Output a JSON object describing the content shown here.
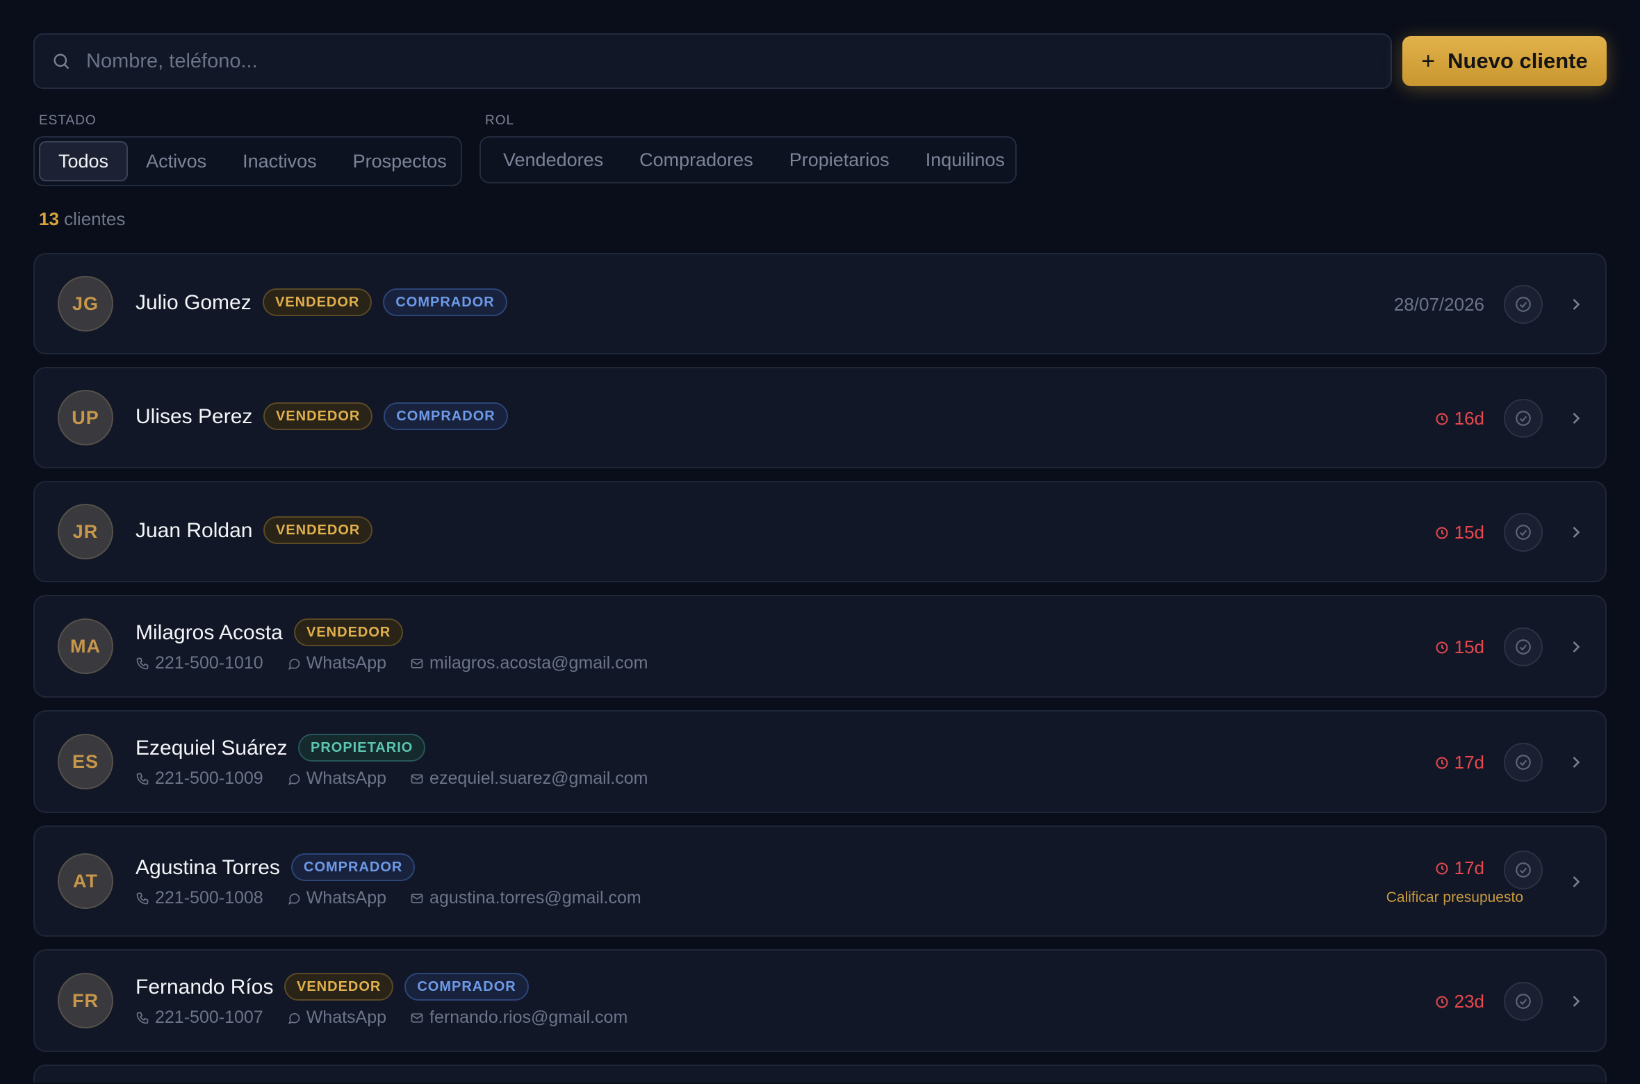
{
  "search": {
    "placeholder": "Nombre, teléfono..."
  },
  "new_client_button": {
    "label": "Nuevo cliente"
  },
  "filters": {
    "estado": {
      "label": "ESTADO",
      "options": [
        "Todos",
        "Activos",
        "Inactivos",
        "Prospectos"
      ],
      "selected": "Todos"
    },
    "rol": {
      "label": "ROL",
      "options": [
        "Vendedores",
        "Compradores",
        "Propietarios",
        "Inquilinos"
      ]
    }
  },
  "summary": {
    "count": "13",
    "suffix": "clientes"
  },
  "clients": [
    {
      "initials": "JG",
      "name": "Julio Gomez",
      "roles": [
        "VENDEDOR",
        "COMPRADOR"
      ],
      "status_text": "28/07/2026",
      "status_kind": "date"
    },
    {
      "initials": "UP",
      "name": "Ulises Perez",
      "roles": [
        "VENDEDOR",
        "COMPRADOR"
      ],
      "status_text": "16d",
      "status_kind": "overdue"
    },
    {
      "initials": "JR",
      "name": "Juan Roldan",
      "roles": [
        "VENDEDOR"
      ],
      "status_text": "15d",
      "status_kind": "overdue"
    },
    {
      "initials": "MA",
      "name": "Milagros Acosta",
      "roles": [
        "VENDEDOR"
      ],
      "phone": "221-500-1010",
      "channel": "WhatsApp",
      "email": "milagros.acosta@gmail.com",
      "status_text": "15d",
      "status_kind": "overdue"
    },
    {
      "initials": "ES",
      "name": "Ezequiel Suárez",
      "roles": [
        "PROPIETARIO"
      ],
      "phone": "221-500-1009",
      "channel": "WhatsApp",
      "email": "ezequiel.suarez@gmail.com",
      "status_text": "17d",
      "status_kind": "overdue"
    },
    {
      "initials": "AT",
      "name": "Agustina Torres",
      "roles": [
        "COMPRADOR"
      ],
      "phone": "221-500-1008",
      "channel": "WhatsApp",
      "email": "agustina.torres@gmail.com",
      "status_text": "17d",
      "status_kind": "overdue",
      "hint": "Calificar presupuesto"
    },
    {
      "initials": "FR",
      "name": "Fernando Ríos",
      "roles": [
        "VENDEDOR",
        "COMPRADOR"
      ],
      "phone": "221-500-1007",
      "channel": "WhatsApp",
      "email": "fernando.rios@gmail.com",
      "status_text": "23d",
      "status_kind": "overdue"
    }
  ],
  "colors": {
    "accent": "#d8a53c",
    "overdue": "#e5484d",
    "vendedor": "#e1b04d",
    "comprador": "#6e9ae8",
    "propietario": "#5cc6b2"
  },
  "icons": {
    "search": "search-icon",
    "phone": "phone-icon",
    "whatsapp": "chat-bubble-icon",
    "email": "mail-icon",
    "clock": "clock-icon",
    "check": "check-circle-icon",
    "chevron": "chevron-right-icon"
  }
}
